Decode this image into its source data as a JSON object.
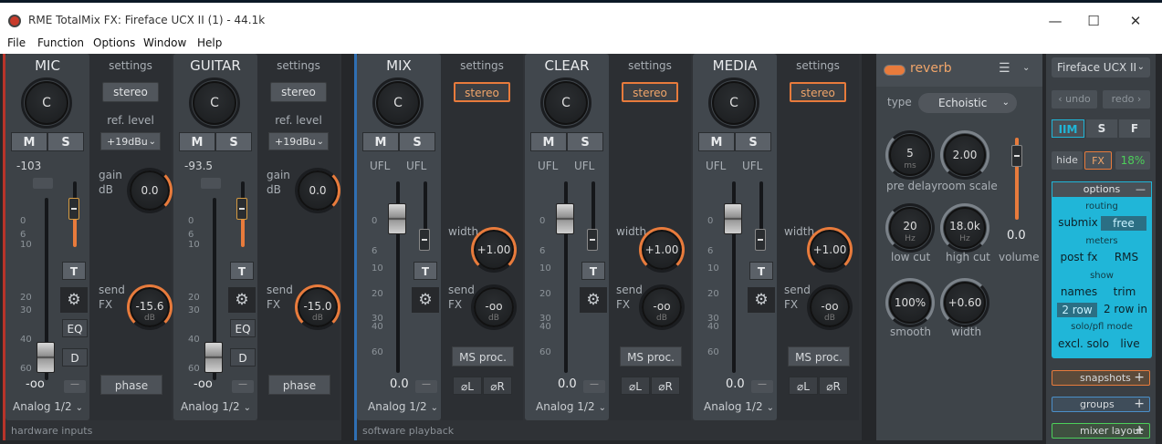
{
  "window": {
    "title": "RME TotalMix FX: Fireface UCX II (1) - 44.1k",
    "min": "—",
    "max": "☐",
    "close": "✕"
  },
  "menu": [
    "File",
    "Function",
    "Options",
    "Window",
    "Help"
  ],
  "sections": {
    "hardware_inputs": "hardware inputs",
    "software_playback": "software playback"
  },
  "inputs": [
    {
      "name": "MIC",
      "pan": "C",
      "mute": "M",
      "solo": "S",
      "level": "-103",
      "settings": "settings",
      "stereo": "stereo",
      "ref_label": "ref. level",
      "ref": "+19dBu",
      "gain_label": "gain",
      "gain_unit": "dB",
      "gain": "0.0",
      "send_label": "send",
      "fx_label": "FX",
      "send": "-15.6",
      "send_unit": "dB",
      "phase": "phase",
      "vol": "-oo",
      "dash": "—",
      "t": "T",
      "eq": "EQ",
      "d": "D",
      "assign": "Analog 1/2"
    },
    {
      "name": "GUITAR",
      "pan": "C",
      "mute": "M",
      "solo": "S",
      "level": "-93.5",
      "settings": "settings",
      "stereo": "stereo",
      "ref_label": "ref. level",
      "ref": "+19dBu",
      "gain_label": "gain",
      "gain_unit": "dB",
      "gain": "0.0",
      "send_label": "send",
      "fx_label": "FX",
      "send": "-15.0",
      "send_unit": "dB",
      "phase": "phase",
      "vol": "-oo",
      "dash": "—",
      "t": "T",
      "eq": "EQ",
      "d": "D",
      "assign": "Analog 1/2"
    }
  ],
  "playback": [
    {
      "name": "MIX",
      "pan": "C",
      "mute": "M",
      "solo": "S",
      "ufl1": "UFL",
      "ufl2": "UFL",
      "settings": "settings",
      "stereo": "stereo",
      "width_label": "width",
      "width": "+1.00",
      "send_label": "send",
      "fx_label": "FX",
      "send": "-oo",
      "send_unit": "dB",
      "msproc": "MS proc.",
      "phl": "⌀L",
      "phr": "⌀R",
      "vol": "0.0",
      "dash": "—",
      "t": "T",
      "assign": "Analog 1/2"
    },
    {
      "name": "CLEAR",
      "pan": "C",
      "mute": "M",
      "solo": "S",
      "ufl1": "UFL",
      "ufl2": "UFL",
      "settings": "settings",
      "stereo": "stereo",
      "width_label": "width",
      "width": "+1.00",
      "send_label": "send",
      "fx_label": "FX",
      "send": "-oo",
      "send_unit": "dB",
      "msproc": "MS proc.",
      "phl": "⌀L",
      "phr": "⌀R",
      "vol": "0.0",
      "dash": "—",
      "t": "T",
      "assign": "Analog 1/2"
    },
    {
      "name": "MEDIA",
      "pan": "C",
      "mute": "M",
      "solo": "S",
      "ufl1": "UFL",
      "ufl2": "UFL",
      "settings": "settings",
      "stereo": "stereo",
      "width_label": "width",
      "width": "+1.00",
      "send_label": "send",
      "fx_label": "FX",
      "send": "-oo",
      "send_unit": "dB",
      "msproc": "MS proc.",
      "phl": "⌀L",
      "phr": "⌀R",
      "vol": "0.0",
      "dash": "—",
      "t": "T",
      "assign": "Analog 1/2"
    }
  ],
  "scale_in": [
    "0",
    "6",
    "10",
    "20",
    "30",
    "40",
    "60"
  ],
  "scale_pb": [
    "0",
    "6",
    "10",
    "20",
    "30",
    "40",
    "60"
  ],
  "reverb": {
    "title": "reverb",
    "type_label": "type",
    "type": "Echoistic",
    "predelay": "5",
    "predelay_unit": "ms",
    "predelay_label": "pre delay",
    "roomscale": "2.00",
    "roomscale_label": "room scale",
    "lowcut": "20",
    "lowcut_unit": "Hz",
    "lowcut_label": "low cut",
    "highcut": "18.0k",
    "highcut_unit": "Hz",
    "highcut_label": "high cut",
    "smooth": "100%",
    "smooth_label": "smooth",
    "width": "+0.60",
    "width_label": "width",
    "volume": "0.0",
    "volume_label": "volume"
  },
  "side": {
    "device": "Fireface UCX II",
    "undo": "undo",
    "redo": "redo",
    "seg": [
      "IIM",
      "S",
      "F"
    ],
    "hide": "hide",
    "fx": "FX",
    "dsp": "18%",
    "options": "options",
    "minus": "—",
    "routing": "routing",
    "submix": "submix",
    "free": "free",
    "meters": "meters",
    "postfx": "post fx",
    "rms": "RMS",
    "show": "show",
    "names": "names",
    "trim": "trim",
    "row2": "2 row",
    "row2in": "2 row in",
    "solopfl": "solo/pfl mode",
    "exclsolo": "excl. solo",
    "live": "live",
    "snapshots": "snapshots",
    "groups": "groups",
    "mixerlayout": "mixer layout",
    "plus": "+"
  },
  "colors": {
    "accent": "#e87b3c",
    "cyan": "#20b6d8",
    "green": "#4ccf5a"
  }
}
